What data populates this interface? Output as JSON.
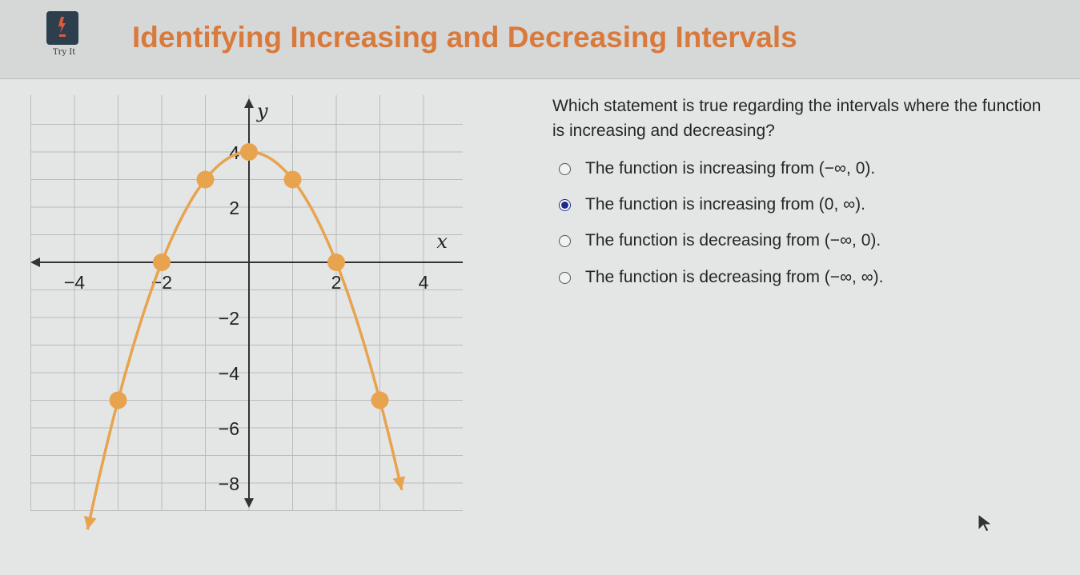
{
  "header": {
    "title": "Identifying Increasing and Decreasing Intervals",
    "icon_caption": "Try It",
    "accent_color": "#d97a3d"
  },
  "question": {
    "prompt": "Which statement is true regarding the intervals where the function is increasing and decreasing?",
    "options": [
      {
        "label": "The function is increasing from (−∞, 0).",
        "selected": false
      },
      {
        "label": "The function is increasing from (0, ∞).",
        "selected": true
      },
      {
        "label": "The function is decreasing from (−∞, 0).",
        "selected": false
      },
      {
        "label": "The function is decreasing from (−∞, ∞).",
        "selected": false
      }
    ]
  },
  "chart_data": {
    "type": "line",
    "x_axis_label": "x",
    "y_axis_label": "y",
    "x_ticks": [
      {
        "value": -4,
        "label": "−4"
      },
      {
        "value": -2,
        "label": "−2"
      },
      {
        "value": 2,
        "label": "2"
      },
      {
        "value": 4,
        "label": "4"
      }
    ],
    "y_ticks": [
      {
        "value": 4,
        "label": "4"
      },
      {
        "value": 2,
        "label": "2"
      },
      {
        "value": -2,
        "label": "−2"
      },
      {
        "value": -4,
        "label": "−4"
      },
      {
        "value": -6,
        "label": "−6"
      },
      {
        "value": -8,
        "label": "−8"
      }
    ],
    "xlim": [
      -5.5,
      4.8
    ],
    "ylim": [
      -9,
      5.8
    ],
    "grid": true,
    "curve_color": "#e8a34f",
    "points": [
      {
        "x": -3,
        "y": -5
      },
      {
        "x": -2,
        "y": 0
      },
      {
        "x": -1,
        "y": 3
      },
      {
        "x": 0,
        "y": 4
      },
      {
        "x": 1,
        "y": 3
      },
      {
        "x": 2,
        "y": 0
      },
      {
        "x": 3,
        "y": -5
      }
    ],
    "curve": {
      "function": "y = -x^2 + 4",
      "x_start": -3.7,
      "x_end": 3.5
    }
  }
}
